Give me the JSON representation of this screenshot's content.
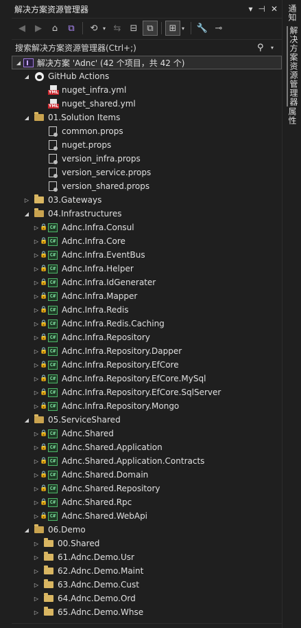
{
  "window": {
    "title": "解决方案资源管理器",
    "title_icons": [
      "dropdown-icon",
      "pin-icon",
      "close-icon"
    ]
  },
  "toolbar": {
    "buttons": [
      "back-icon",
      "forward-icon",
      "home-icon",
      "vs-switch-icon",
      "history-icon",
      "sync-icon",
      "collapse-all-icon",
      "show-all-files-icon",
      "preview-icon",
      "properties-icon",
      "pending-changes-icon"
    ]
  },
  "search": {
    "placeholder": "搜索解决方案资源管理器(Ctrl+;)",
    "value": ""
  },
  "solution": {
    "label": "解决方案 'Adnc' (42 个项目，共 42 个)"
  },
  "tree": [
    {
      "label": "GitHub Actions",
      "icon": "github-icon",
      "level": 1,
      "expander": "expanded",
      "locked": false,
      "kind": "github"
    },
    {
      "label": "nuget_infra.yml",
      "icon": "yml-file-icon",
      "level": 2,
      "expander": "none",
      "locked": false,
      "kind": "yml"
    },
    {
      "label": "nuget_shared.yml",
      "icon": "yml-file-icon",
      "level": 2,
      "expander": "none",
      "locked": false,
      "kind": "yml"
    },
    {
      "label": "01.Solution Items",
      "icon": "folder-icon",
      "level": 1,
      "expander": "expanded",
      "locked": false,
      "kind": "folder-open"
    },
    {
      "label": "common.props",
      "icon": "props-file-icon",
      "level": 2,
      "expander": "none",
      "locked": false,
      "kind": "props"
    },
    {
      "label": "nuget.props",
      "icon": "props-file-icon",
      "level": 2,
      "expander": "none",
      "locked": false,
      "kind": "props"
    },
    {
      "label": "version_infra.props",
      "icon": "props-file-icon",
      "level": 2,
      "expander": "none",
      "locked": false,
      "kind": "props"
    },
    {
      "label": "version_service.props",
      "icon": "props-file-icon",
      "level": 2,
      "expander": "none",
      "locked": false,
      "kind": "props"
    },
    {
      "label": "version_shared.props",
      "icon": "props-file-icon",
      "level": 2,
      "expander": "none",
      "locked": false,
      "kind": "props"
    },
    {
      "label": "03.Gateways",
      "icon": "folder-icon",
      "level": 1,
      "expander": "collapsed",
      "locked": false,
      "kind": "folder"
    },
    {
      "label": "04.Infrastructures",
      "icon": "folder-icon",
      "level": 1,
      "expander": "expanded",
      "locked": false,
      "kind": "folder-open"
    },
    {
      "label": "Adnc.Infra.Consul",
      "icon": "csharp-project-icon",
      "level": 2,
      "expander": "collapsed",
      "locked": true,
      "kind": "csproj"
    },
    {
      "label": "Adnc.Infra.Core",
      "icon": "csharp-project-icon",
      "level": 2,
      "expander": "collapsed",
      "locked": true,
      "kind": "csproj"
    },
    {
      "label": "Adnc.Infra.EventBus",
      "icon": "csharp-project-icon",
      "level": 2,
      "expander": "collapsed",
      "locked": true,
      "kind": "csproj"
    },
    {
      "label": "Adnc.Infra.Helper",
      "icon": "csharp-project-icon",
      "level": 2,
      "expander": "collapsed",
      "locked": true,
      "kind": "csproj"
    },
    {
      "label": "Adnc.Infra.IdGenerater",
      "icon": "csharp-project-icon",
      "level": 2,
      "expander": "collapsed",
      "locked": true,
      "kind": "csproj"
    },
    {
      "label": "Adnc.Infra.Mapper",
      "icon": "csharp-project-icon",
      "level": 2,
      "expander": "collapsed",
      "locked": true,
      "kind": "csproj"
    },
    {
      "label": "Adnc.Infra.Redis",
      "icon": "csharp-project-icon",
      "level": 2,
      "expander": "collapsed",
      "locked": true,
      "kind": "csproj"
    },
    {
      "label": "Adnc.Infra.Redis.Caching",
      "icon": "csharp-project-icon",
      "level": 2,
      "expander": "collapsed",
      "locked": true,
      "kind": "csproj"
    },
    {
      "label": "Adnc.Infra.Repository",
      "icon": "csharp-project-icon",
      "level": 2,
      "expander": "collapsed",
      "locked": true,
      "kind": "csproj"
    },
    {
      "label": "Adnc.Infra.Repository.Dapper",
      "icon": "csharp-project-icon",
      "level": 2,
      "expander": "collapsed",
      "locked": true,
      "kind": "csproj"
    },
    {
      "label": "Adnc.Infra.Repository.EfCore",
      "icon": "csharp-project-icon",
      "level": 2,
      "expander": "collapsed",
      "locked": true,
      "kind": "csproj"
    },
    {
      "label": "Adnc.Infra.Repository.EfCore.MySql",
      "icon": "csharp-project-icon",
      "level": 2,
      "expander": "collapsed",
      "locked": true,
      "kind": "csproj"
    },
    {
      "label": "Adnc.Infra.Repository.EfCore.SqlServer",
      "icon": "csharp-project-icon",
      "level": 2,
      "expander": "collapsed",
      "locked": true,
      "kind": "csproj"
    },
    {
      "label": "Adnc.Infra.Repository.Mongo",
      "icon": "csharp-project-icon",
      "level": 2,
      "expander": "collapsed",
      "locked": true,
      "kind": "csproj"
    },
    {
      "label": "05.ServiceShared",
      "icon": "folder-icon",
      "level": 1,
      "expander": "expanded",
      "locked": false,
      "kind": "folder-open"
    },
    {
      "label": "Adnc.Shared",
      "icon": "csharp-project-icon",
      "level": 2,
      "expander": "collapsed",
      "locked": true,
      "kind": "csproj"
    },
    {
      "label": "Adnc.Shared.Application",
      "icon": "csharp-project-icon",
      "level": 2,
      "expander": "collapsed",
      "locked": true,
      "kind": "csproj"
    },
    {
      "label": "Adnc.Shared.Application.Contracts",
      "icon": "csharp-project-icon",
      "level": 2,
      "expander": "collapsed",
      "locked": true,
      "kind": "csproj"
    },
    {
      "label": "Adnc.Shared.Domain",
      "icon": "csharp-project-icon",
      "level": 2,
      "expander": "collapsed",
      "locked": true,
      "kind": "csproj"
    },
    {
      "label": "Adnc.Shared.Repository",
      "icon": "csharp-project-icon",
      "level": 2,
      "expander": "collapsed",
      "locked": true,
      "kind": "csproj"
    },
    {
      "label": "Adnc.Shared.Rpc",
      "icon": "csharp-project-icon",
      "level": 2,
      "expander": "collapsed",
      "locked": true,
      "kind": "csproj"
    },
    {
      "label": "Adnc.Shared.WebApi",
      "icon": "csharp-project-icon",
      "level": 2,
      "expander": "collapsed",
      "locked": true,
      "kind": "csproj"
    },
    {
      "label": "06.Demo",
      "icon": "folder-icon",
      "level": 1,
      "expander": "expanded",
      "locked": false,
      "kind": "folder-open"
    },
    {
      "label": "00.Shared",
      "icon": "folder-icon",
      "level": 2,
      "expander": "collapsed",
      "locked": false,
      "kind": "folder"
    },
    {
      "label": "61.Adnc.Demo.Usr",
      "icon": "folder-icon",
      "level": 2,
      "expander": "collapsed",
      "locked": false,
      "kind": "folder"
    },
    {
      "label": "62.Adnc.Demo.Maint",
      "icon": "folder-icon",
      "level": 2,
      "expander": "collapsed",
      "locked": false,
      "kind": "folder"
    },
    {
      "label": "63.Adnc.Demo.Cust",
      "icon": "folder-icon",
      "level": 2,
      "expander": "collapsed",
      "locked": false,
      "kind": "folder"
    },
    {
      "label": "64.Adnc.Demo.Ord",
      "icon": "folder-icon",
      "level": 2,
      "expander": "collapsed",
      "locked": false,
      "kind": "folder"
    },
    {
      "label": "65.Adnc.Demo.Whse",
      "icon": "folder-icon",
      "level": 2,
      "expander": "collapsed",
      "locked": false,
      "kind": "folder"
    }
  ],
  "side_tabs": [
    {
      "label": "通知"
    },
    {
      "label": "解决方案资源管理器"
    },
    {
      "label": "属性"
    }
  ],
  "colors": {
    "background": "#1f1f1f",
    "text": "#e0e0e0",
    "lock_blue": "#56a0e8",
    "folder_yellow": "#d9b662",
    "csharp_green": "#4fb86a"
  }
}
